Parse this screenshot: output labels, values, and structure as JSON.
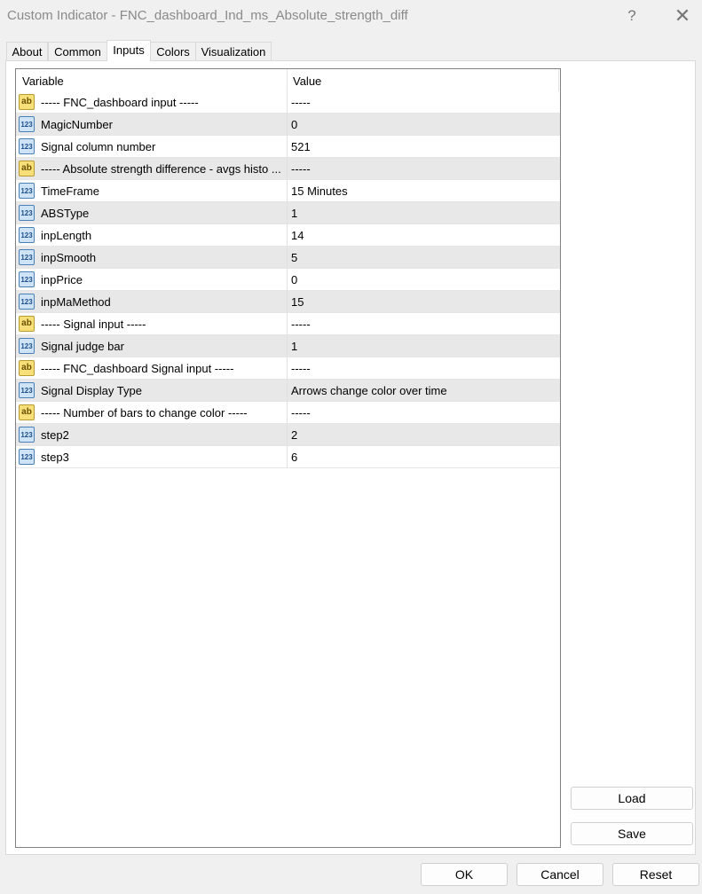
{
  "window": {
    "title": "Custom Indicator - FNC_dashboard_Ind_ms_Absolute_strength_diff",
    "help_glyph": "?",
    "close_glyph": "✕"
  },
  "tabs": [
    {
      "label": "About"
    },
    {
      "label": "Common"
    },
    {
      "label": "Inputs",
      "active": true
    },
    {
      "label": "Colors"
    },
    {
      "label": "Visualization"
    }
  ],
  "grid": {
    "col_variable": "Variable",
    "col_value": "Value",
    "rows": [
      {
        "icon": "ab",
        "variable": "----- FNC_dashboard input -----",
        "value": "-----"
      },
      {
        "icon": "123",
        "variable": "MagicNumber",
        "value": "0"
      },
      {
        "icon": "123",
        "variable": "Signal column number",
        "value": "521"
      },
      {
        "icon": "ab",
        "variable": "----- Absolute strength difference - avgs histo ...",
        "value": "-----"
      },
      {
        "icon": "123",
        "variable": "TimeFrame",
        "value": "15 Minutes"
      },
      {
        "icon": "123",
        "variable": "ABSType",
        "value": "1"
      },
      {
        "icon": "123",
        "variable": "inpLength",
        "value": "14"
      },
      {
        "icon": "123",
        "variable": "inpSmooth",
        "value": "5"
      },
      {
        "icon": "123",
        "variable": "inpPrice",
        "value": "0"
      },
      {
        "icon": "123",
        "variable": "inpMaMethod",
        "value": "15"
      },
      {
        "icon": "ab",
        "variable": "----- Signal input -----",
        "value": "-----"
      },
      {
        "icon": "123",
        "variable": "Signal judge bar",
        "value": "1"
      },
      {
        "icon": "ab",
        "variable": "----- FNC_dashboard Signal input -----",
        "value": "-----"
      },
      {
        "icon": "123",
        "variable": "Signal Display Type",
        "value": "Arrows change color over time"
      },
      {
        "icon": "ab",
        "variable": "----- Number of bars to change color -----",
        "value": "-----"
      },
      {
        "icon": "123",
        "variable": "step2",
        "value": "2"
      },
      {
        "icon": "123",
        "variable": "step3",
        "value": "6"
      }
    ]
  },
  "side_buttons": {
    "load": "Load",
    "save": "Save"
  },
  "footer": {
    "ok": "OK",
    "cancel": "Cancel",
    "reset": "Reset"
  }
}
